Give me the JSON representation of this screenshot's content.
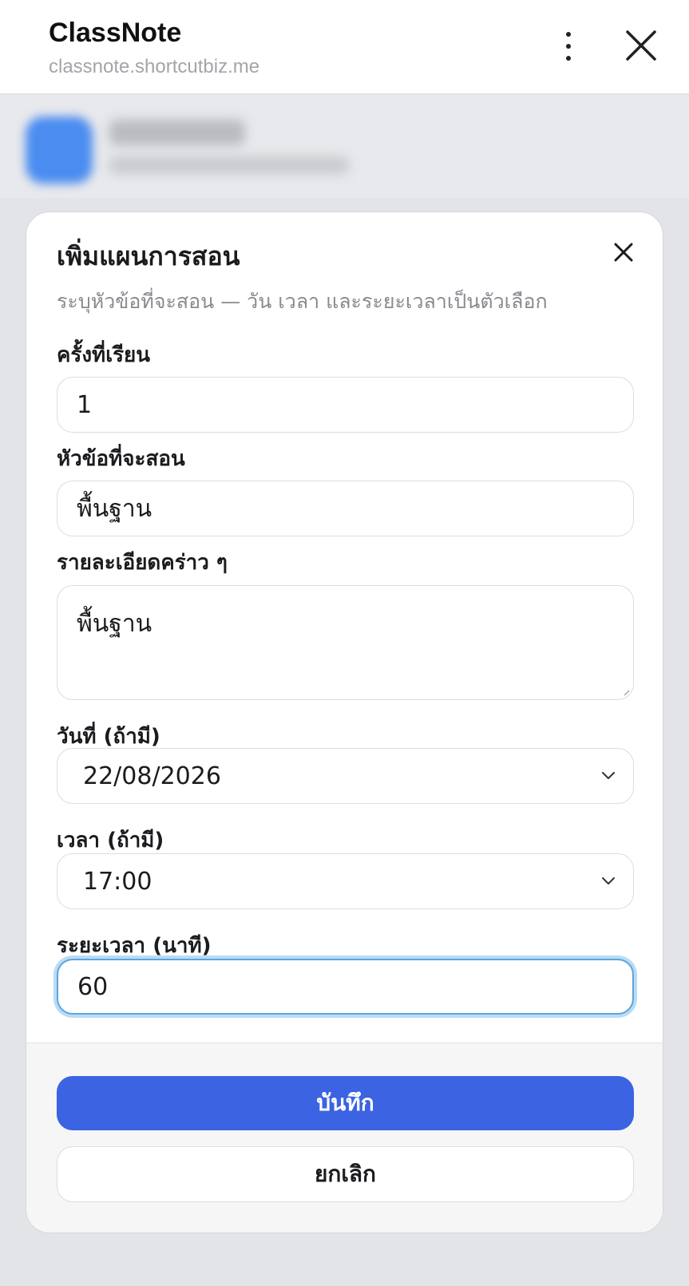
{
  "browser": {
    "title": "ClassNote",
    "url": "classnote.shortcutbiz.me"
  },
  "sheet": {
    "title": "เพิ่มแผนการสอน",
    "subtitle": "ระบุหัวข้อที่จะสอน — วัน เวลา และระยะเวลาเป็นตัวเลือก",
    "fields": {
      "session": {
        "label": "ครั้งที่เรียน",
        "value": "1"
      },
      "topic": {
        "label": "หัวข้อที่จะสอน",
        "value": "พื้นฐาน"
      },
      "detail": {
        "label": "รายละเอียดคร่าว ๆ",
        "value": "พื้นฐาน"
      },
      "date": {
        "label": "วันที่ (ถ้ามี)",
        "value": "22/08/2026"
      },
      "time": {
        "label": "เวลา (ถ้ามี)",
        "value": "17:00"
      },
      "duration": {
        "label": "ระยะเวลา (นาที)",
        "value": "60"
      }
    },
    "buttons": {
      "save": "บันทึก",
      "cancel": "ยกเลิก"
    }
  },
  "colors": {
    "primary": "#3b63e2",
    "focus_ring": "#5fa4dd"
  },
  "icons": {
    "more": "more-vertical-icon",
    "close": "close-icon",
    "chevron": "chevron-down-icon"
  }
}
